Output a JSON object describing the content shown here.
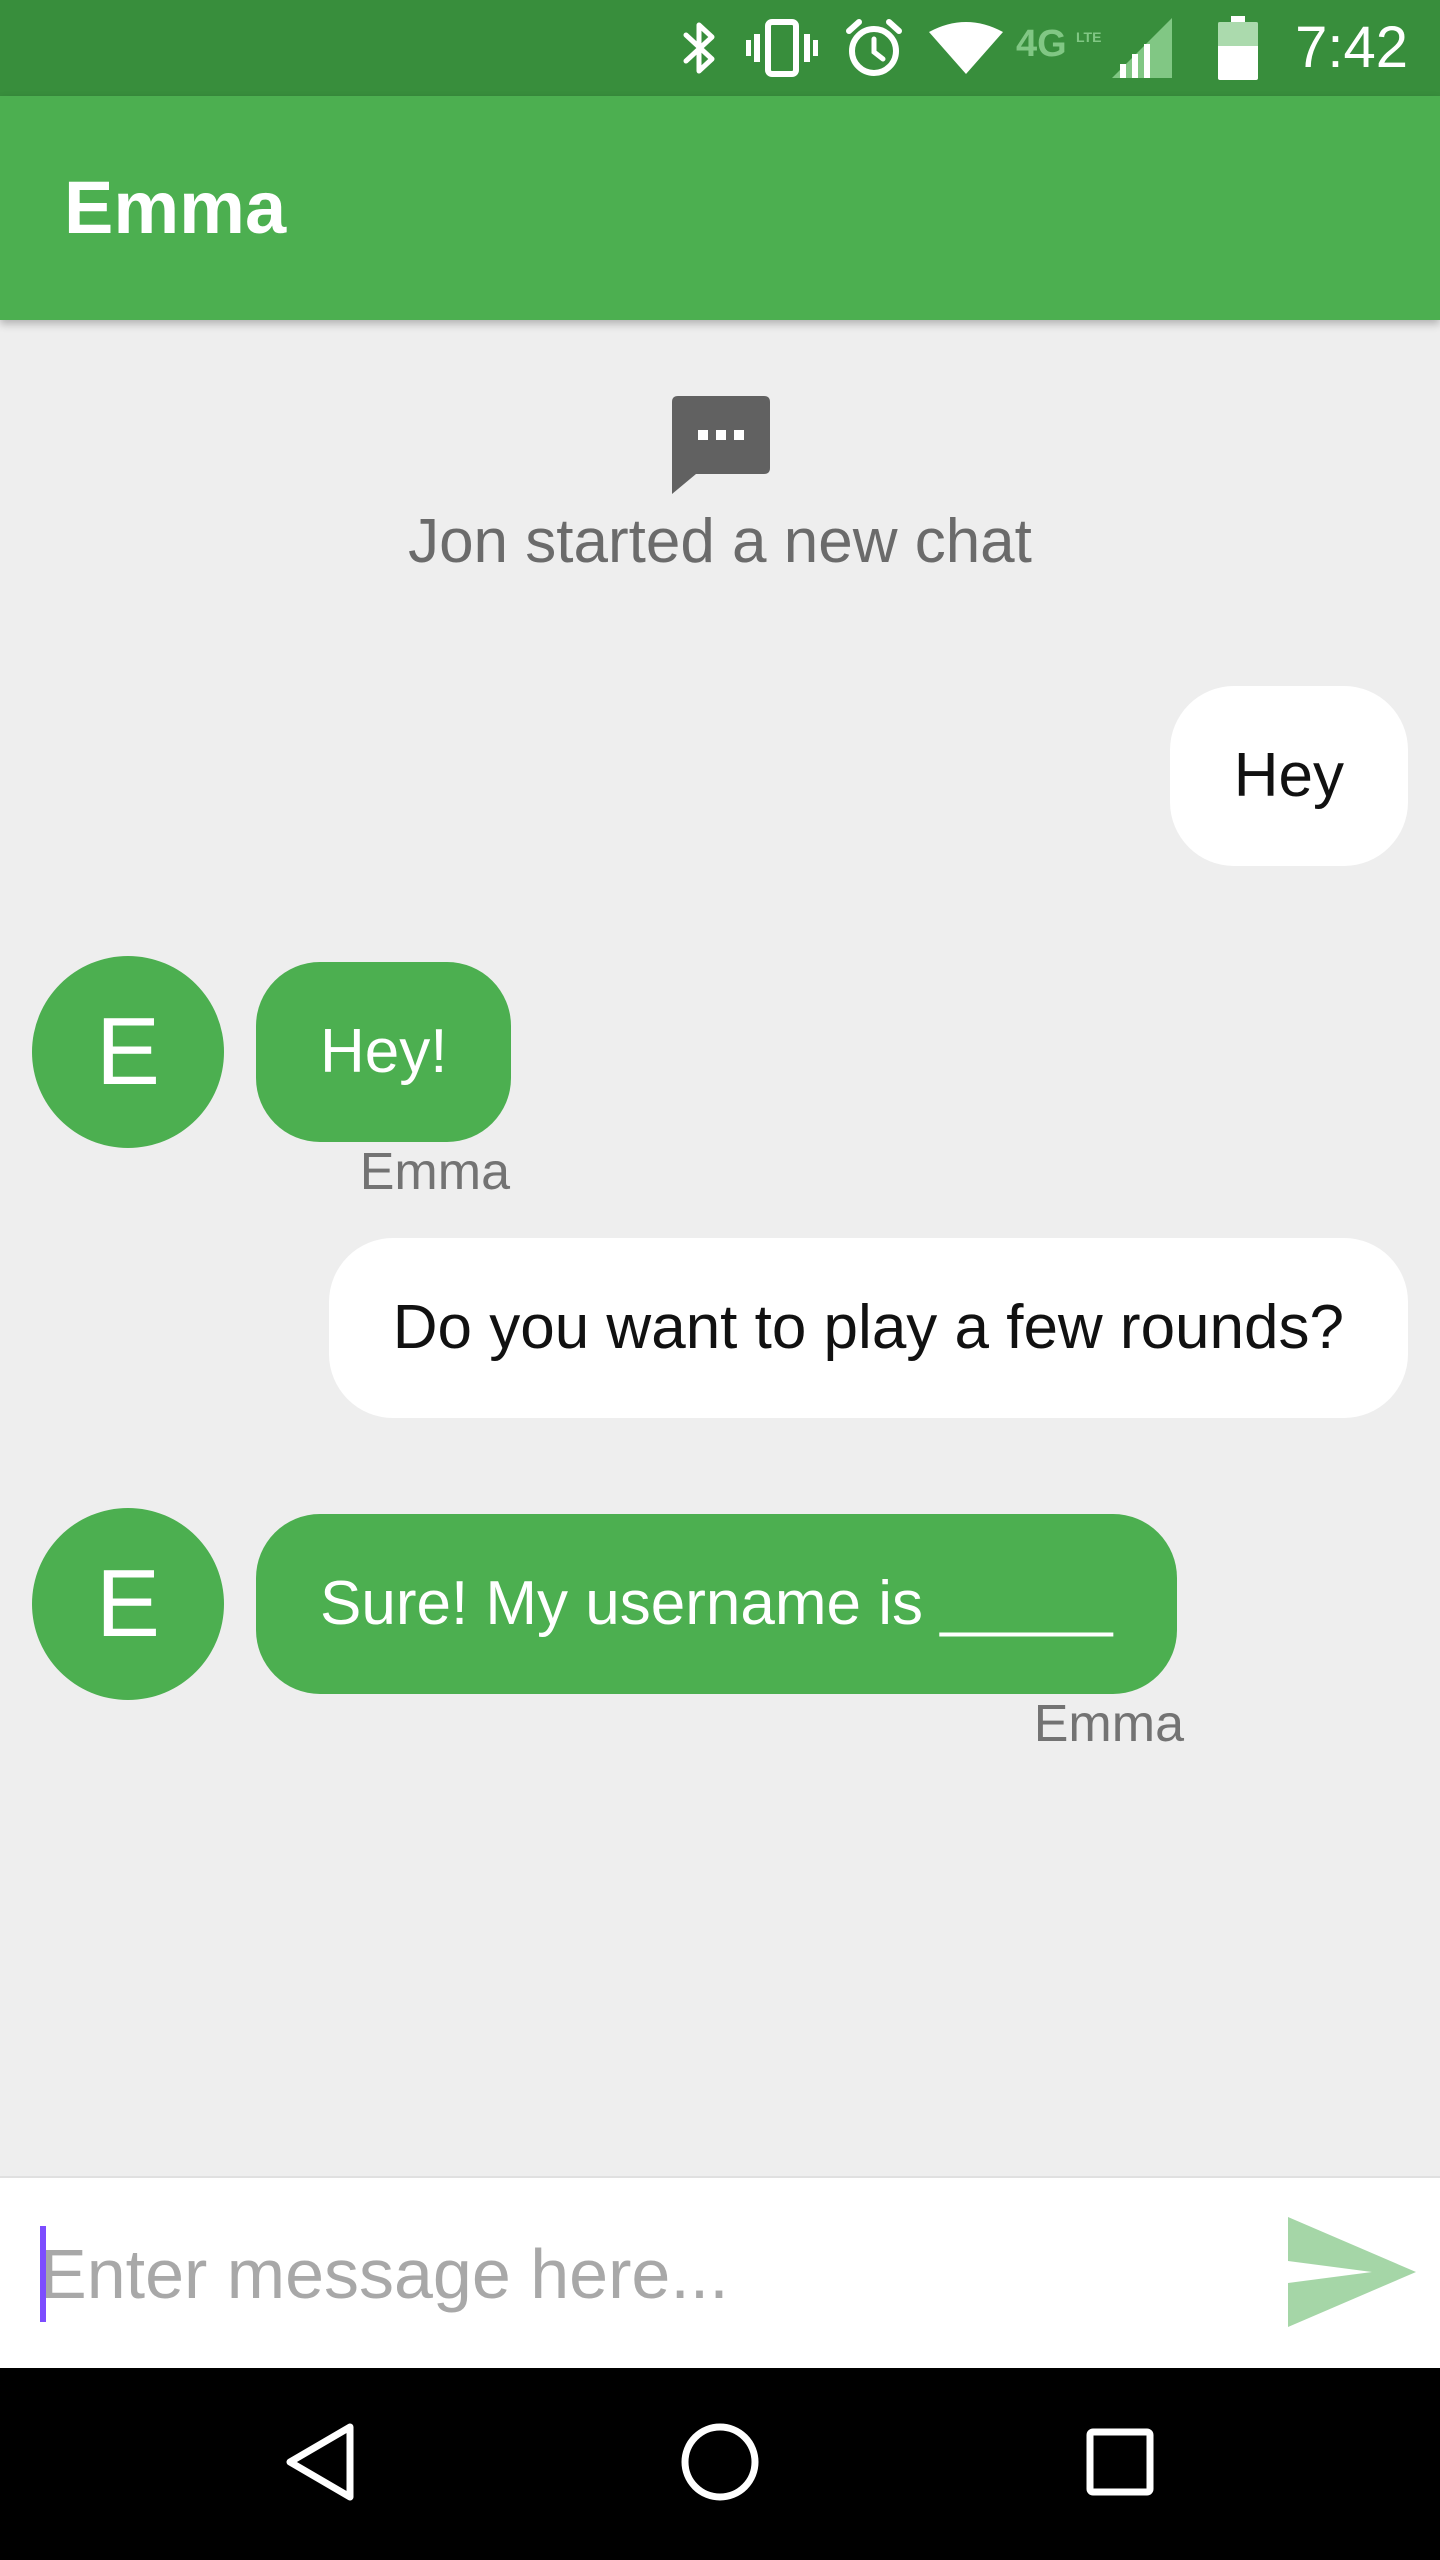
{
  "status_bar": {
    "time": "7:42",
    "network_label": "4G LTE",
    "icons": [
      "bluetooth-icon",
      "vibrate-icon",
      "alarm-icon",
      "wifi-icon",
      "lte-icon",
      "cell-signal-icon",
      "battery-icon"
    ]
  },
  "app_bar": {
    "title": "Emma"
  },
  "chat": {
    "system_message": {
      "icon": "chat-bubble-icon",
      "text": "Jon started a new chat"
    },
    "messages": [
      {
        "direction": "outgoing",
        "text": "Hey"
      },
      {
        "direction": "incoming",
        "avatar_letter": "E",
        "text": "Hey!",
        "sender": "Emma"
      },
      {
        "direction": "outgoing",
        "text": "Do you want to play a few rounds?"
      },
      {
        "direction": "incoming",
        "avatar_letter": "E",
        "text": "Sure! My username is _____",
        "sender": "Emma"
      }
    ]
  },
  "composer": {
    "placeholder": "Enter message here...",
    "value": "",
    "send_icon": "send-icon"
  },
  "nav_bar": {
    "icons": [
      "back-icon",
      "home-icon",
      "recents-icon"
    ]
  },
  "colors": {
    "status_bar": "#388E3C",
    "primary": "#4CAF50",
    "background": "#EEEEEE",
    "outgoing_bubble": "#FFFFFF",
    "send_icon": "#A5D6A7",
    "cursor": "#7C4DFF",
    "nav_bar": "#000000"
  }
}
